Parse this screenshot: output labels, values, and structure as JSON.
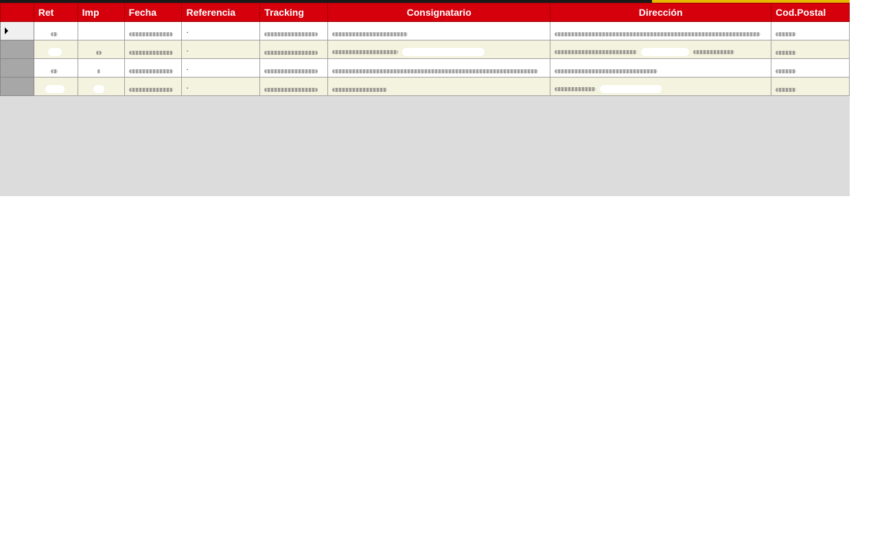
{
  "grid": {
    "columns": [
      {
        "key": "ret",
        "label": "Ret"
      },
      {
        "key": "imp",
        "label": "Imp"
      },
      {
        "key": "fecha",
        "label": "Fecha"
      },
      {
        "key": "referencia",
        "label": "Referencia"
      },
      {
        "key": "tracking",
        "label": "Tracking"
      },
      {
        "key": "consignatario",
        "label": "Consignatario"
      },
      {
        "key": "direccion",
        "label": "Dirección"
      },
      {
        "key": "cod_postal",
        "label": "Cod.Postal"
      }
    ],
    "rows": [
      {
        "referencia": ".",
        "selected": true
      },
      {
        "referencia": ".",
        "selected": false
      },
      {
        "referencia": ".",
        "selected": false
      },
      {
        "referencia": ".",
        "selected": false
      }
    ]
  },
  "icons": {
    "row_indicator": "current-row-arrow-icon"
  },
  "colors": {
    "header_bg": "#d6000c",
    "header_text": "#ffffff",
    "row_alt": "#f3f3df",
    "empty_area": "#dcdcdc"
  }
}
